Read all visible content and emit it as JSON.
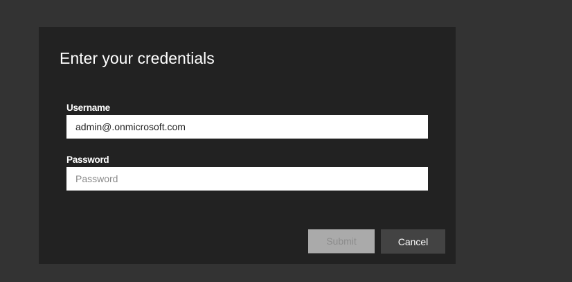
{
  "dialog": {
    "title": "Enter your credentials",
    "username_label": "Username",
    "username_value": "admin@.onmicrosoft.com",
    "password_label": "Password",
    "password_placeholder": "Password",
    "submit_label": "Submit",
    "cancel_label": "Cancel"
  },
  "colors": {
    "background": "#333333",
    "dialog": "#222222",
    "submit_disabled": "#aaaaaa",
    "cancel": "#434343"
  }
}
